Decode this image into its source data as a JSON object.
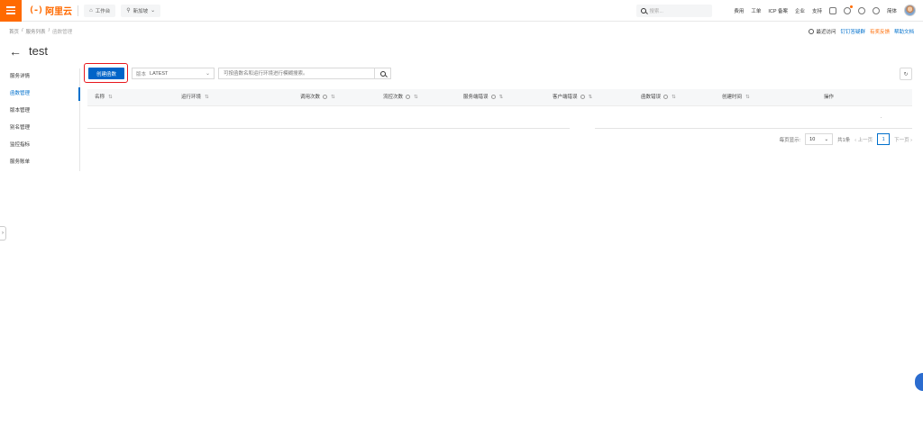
{
  "topbar": {
    "logo_mark": "(-)",
    "logo_text": "阿里云",
    "workbench": "工作台",
    "region": "新加坡",
    "search_placeholder": "搜索...",
    "links": [
      "费用",
      "工单",
      "ICP 备案",
      "企业",
      "支持"
    ],
    "language": "简体"
  },
  "breadcrumb": {
    "items": [
      "首页",
      "服务列表",
      "函数管理"
    ],
    "separator": "/"
  },
  "quick_links": {
    "recent": "最近访问",
    "dingtalk": "钉钉答疑群",
    "feedback": "有奖反馈",
    "help": "帮助文档"
  },
  "page": {
    "title": "test",
    "back_icon": "arrow-left-icon"
  },
  "leftnav": {
    "items": [
      "服务详情",
      "函数管理",
      "版本管理",
      "别名管理",
      "监控指标",
      "服务账单"
    ],
    "active_index": 1
  },
  "toolbar": {
    "create_label": "创建函数",
    "version_label": "版本",
    "version_value": "LATEST",
    "search_placeholder": "可按函数名和运行环境进行模糊搜索。"
  },
  "table": {
    "columns": [
      "名称",
      "运行环境",
      "调用次数",
      "流控次数",
      "服务端错误",
      "客户端错误",
      "函数错误",
      "创建时间",
      "操作"
    ],
    "rows": []
  },
  "pagination": {
    "page_size_label": "每页显示:",
    "page_size": "10",
    "total": "共1条",
    "prev": "上一页",
    "current_page": "1",
    "next": "下一页"
  },
  "colors": {
    "brand_orange": "#ff6a00",
    "primary_blue": "#0064c8",
    "highlight_red": "#e8161c"
  }
}
